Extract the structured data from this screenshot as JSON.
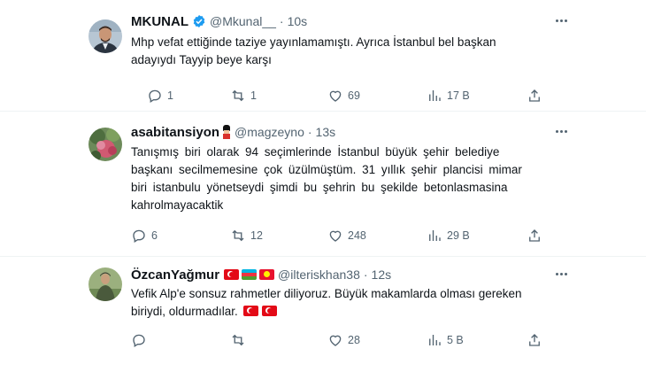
{
  "tweets": [
    {
      "name": "MKUNAL",
      "handle": "@Mkunal__",
      "time": "10s",
      "verified": true,
      "lines": [
        "Mhp vefat ettiğinde taziye yayınlamamıştı. Ayrıca İstanbul bel başkan",
        "adayıydı Tayyip beye karşı"
      ],
      "replies": "1",
      "retweets": "1",
      "likes": "69",
      "views": "17 B"
    },
    {
      "name": "asabitansiyon",
      "handle": "@magzeyno",
      "time": "13s",
      "name_emoji": "guardsman-emoji",
      "lines": [
        "Tanışmış biri olarak 94 seçimlerinde İstanbul büyük şehir belediye",
        "başkanı secilmemesine çok üzülmüştüm. 31 yıllık şehir plancisi mimar",
        "biri istanbulu yönetseydi şimdi bu şehrin bu şekilde betonlasmasina",
        "kahrolmayacaktik"
      ],
      "replies": "6",
      "retweets": "12",
      "likes": "248",
      "views": "29 B"
    },
    {
      "name": "ÖzcanYağmur",
      "handle": "@ilteriskhan38",
      "time": "12s",
      "name_flags": [
        "turkey-flag",
        "azerbaijan-flag",
        "kyrgyzstan-flag"
      ],
      "lines": [
        "Vefik Alp'e sonsuz rahmetler diliyoruz. Büyük makamlarda olması gereken",
        "biriydi, oldurmadılar."
      ],
      "text_flags": [
        "turkey-flag",
        "turkey-flag"
      ],
      "replies": "",
      "retweets": "",
      "likes": "28",
      "views": "5 B"
    }
  ],
  "separator": "·",
  "colors": {
    "text": "#0f1419",
    "secondary": "#536471",
    "verified": "#1d9bf0",
    "divider": "#eff3f4"
  }
}
